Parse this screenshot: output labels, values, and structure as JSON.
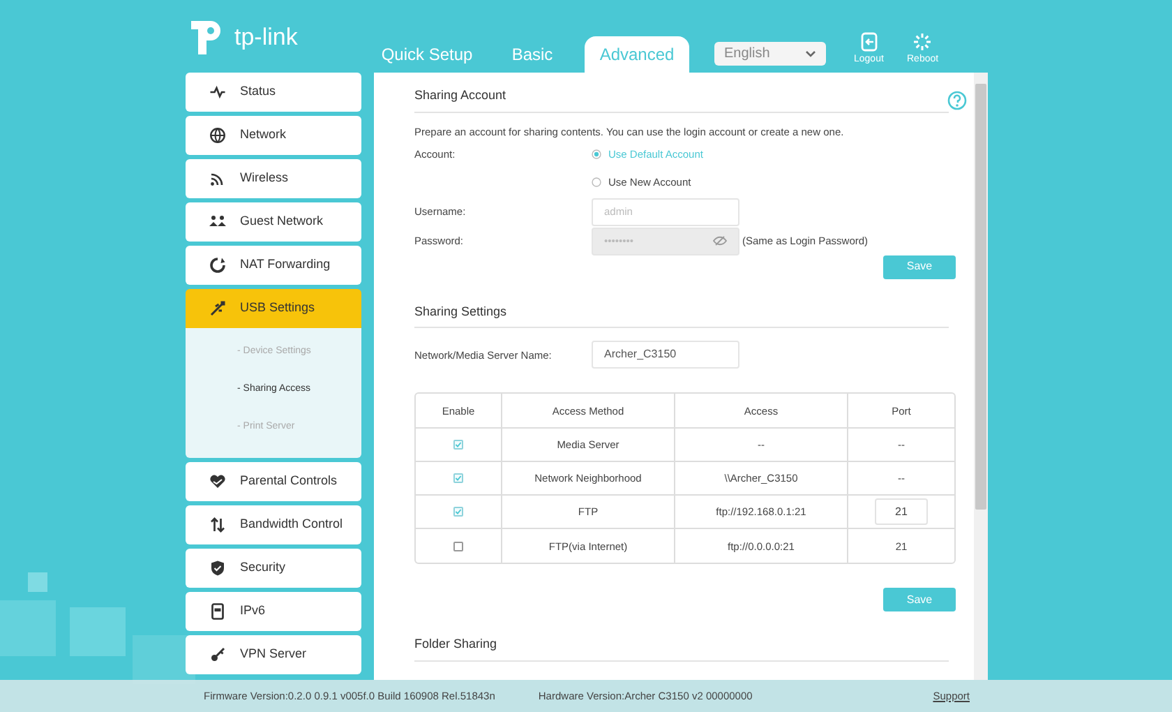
{
  "header": {
    "logo": "tp-link",
    "tabs": [
      {
        "label": "Quick Setup",
        "selected": false
      },
      {
        "label": "Basic",
        "selected": false
      },
      {
        "label": "Advanced",
        "selected": true
      }
    ],
    "language": "English",
    "actions": [
      {
        "kind": "logout",
        "label": "Logout"
      },
      {
        "kind": "reboot",
        "label": "Reboot"
      }
    ]
  },
  "sidebar": {
    "items": [
      {
        "kind": "status",
        "label": "Status",
        "selected": false
      },
      {
        "kind": "network",
        "label": "Network",
        "selected": false
      },
      {
        "kind": "wireless",
        "label": "Wireless",
        "selected": false
      },
      {
        "kind": "guest",
        "label": "Guest Network",
        "selected": false
      },
      {
        "kind": "nat",
        "label": "NAT Forwarding",
        "selected": false
      },
      {
        "kind": "usb",
        "label": "USB Settings",
        "selected": true,
        "children": [
          {
            "label": "- Device Settings",
            "selected": false
          },
          {
            "label": "- Sharing Access",
            "selected": true
          },
          {
            "label": "- Print Server",
            "selected": false
          }
        ]
      },
      {
        "kind": "parental",
        "label": "Parental Controls",
        "selected": false
      },
      {
        "kind": "bandwidth",
        "label": "Bandwidth Control",
        "selected": false
      },
      {
        "kind": "security",
        "label": "Security",
        "selected": false
      },
      {
        "kind": "ipv6",
        "label": "IPv6",
        "selected": false
      },
      {
        "kind": "vpn",
        "label": "VPN Server",
        "selected": false
      }
    ]
  },
  "sharing_account": {
    "title": "Sharing Account",
    "description": "Prepare an account for sharing contents. You can use the login account or create a new one.",
    "account_label": "Account:",
    "options": [
      {
        "label": "Use Default Account",
        "selected": true
      },
      {
        "label": "Use New Account",
        "selected": false
      }
    ],
    "username": {
      "label": "Username:",
      "value": "admin",
      "disabled": true
    },
    "password": {
      "label": "Password:",
      "value": "••••••••",
      "disabled": true,
      "note": "(Same as Login Password)"
    },
    "save": "Save"
  },
  "sharing_settings": {
    "title": "Sharing Settings",
    "server_name_label": "Network/Media Server Name:",
    "server_name": "Archer_C3150",
    "table": {
      "columns": [
        "Enable",
        "Access Method",
        "Access",
        "Port"
      ],
      "rows": [
        {
          "kind": "plain",
          "checked": true,
          "method": "Media Server",
          "access": "--",
          "port": "--"
        },
        {
          "kind": "plain",
          "checked": true,
          "method": "Network Neighborhood",
          "access": "\\\\Archer_C3150",
          "port": "--"
        },
        {
          "kind": "editable",
          "checked": true,
          "method": "FTP",
          "access": "ftp://192.168.0.1:21",
          "port": "21"
        },
        {
          "kind": "plain",
          "checked": false,
          "method": "FTP(via Internet)",
          "access": "ftp://0.0.0.0:21",
          "port": "21"
        }
      ]
    },
    "save": "Save"
  },
  "folder_sharing": {
    "title": "Folder Sharing"
  },
  "footer": {
    "firmware": "Firmware Version:0.2.0 0.9.1 v005f.0 Build 160908 Rel.51843n",
    "hardware": "Hardware Version:Archer C3150 v2 00000000",
    "support": "Support"
  }
}
